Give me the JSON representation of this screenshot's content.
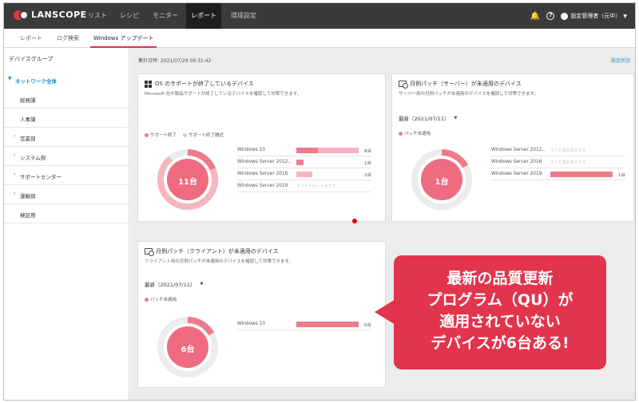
{
  "brand": {
    "name": "LANSCOPE"
  },
  "topnav": {
    "items": [
      {
        "label": "リスト"
      },
      {
        "label": "レシピ"
      },
      {
        "label": "モニター"
      },
      {
        "label": "レポート"
      },
      {
        "label": "環境設定"
      }
    ],
    "active_index": 3,
    "user_label": "設定管理者（元中）"
  },
  "subnav": {
    "tabs": [
      {
        "label": "レポート"
      },
      {
        "label": "ログ検索"
      },
      {
        "label": "Windows アップデート"
      }
    ],
    "active_index": 2
  },
  "sidebar": {
    "title": "デバイスグループ",
    "root": "ネットワーク全体",
    "items": [
      {
        "label": "総務課",
        "expandable": false
      },
      {
        "label": "人事課",
        "expandable": false
      },
      {
        "label": "営業部",
        "expandable": true
      },
      {
        "label": "システム部",
        "expandable": true
      },
      {
        "label": "サポートセンター",
        "expandable": true
      },
      {
        "label": "運輸部",
        "expandable": true
      },
      {
        "label": "検証用",
        "expandable": false
      }
    ]
  },
  "main": {
    "aggregate_time": "集計日時: 2021/07/29 09:31:42",
    "settings_link": "設定状況"
  },
  "colors": {
    "accent": "#e1304a",
    "bar": "#ef7a8a",
    "bar_light": "#f6b6bf",
    "link": "#1c8fbd",
    "callout": "#e3344d"
  },
  "cards": {
    "os": {
      "title": "OS のサポートが終了しているデバイス",
      "desc": "Microsoft 社の製品サポートが終了しているデバイスを確認して対策できます。",
      "legend": [
        "サポート終了",
        "サポート終了間近"
      ],
      "center": "11台",
      "rows": [
        {
          "name": "Windows 10",
          "count": "8台",
          "dark": 0.35,
          "light": 0.65
        },
        {
          "name": "Windows Server 2012...",
          "count": "1台",
          "dark": 0.12,
          "light": 0
        },
        {
          "name": "Windows Server 2016",
          "count": "2台",
          "dark": 0,
          "light": 0.25
        },
        {
          "name": "Windows Server 2019",
          "none": "すべてサポート中です"
        }
      ]
    },
    "server": {
      "title": "月例パッチ（サーバー）が未適用のデバイス",
      "desc": "サーバー用の月例パッチが未適用のデバイスを確認して対策できます。",
      "select": "最新（2021/07/11）",
      "legend": [
        "パッチ未適用"
      ],
      "center": "1台",
      "rows": [
        {
          "name": "Windows Server 2012...",
          "none": "すべて適応済みです"
        },
        {
          "name": "Windows Server 2016",
          "none": "すべて適応済みです"
        },
        {
          "name": "Windows Server 2019",
          "count": "1台",
          "dark": 1.0,
          "light": 0
        }
      ]
    },
    "client": {
      "title": "月例パッチ（クライアント）が未適用のデバイス",
      "desc": "クライアント用の月例パッチが未適用のデバイスを確認して対策できます。",
      "select": "最新（2021/07/11）",
      "legend": [
        "パッチ未適用"
      ],
      "center": "6台",
      "rows": [
        {
          "name": "Windows 10",
          "count": "6台",
          "dark": 1.0,
          "light": 0
        }
      ]
    }
  },
  "callout": {
    "lines": [
      "最新の品質更新",
      "プログラム（QU）が",
      "適用されていない",
      "デバイスが6台ある!"
    ]
  }
}
